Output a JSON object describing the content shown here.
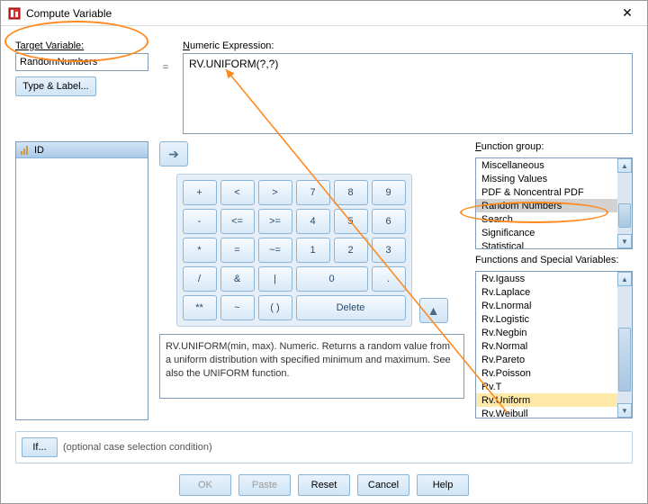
{
  "window": {
    "title": "Compute Variable"
  },
  "labels": {
    "target": "Target Variable:",
    "numeric": "Numeric Expression:",
    "type_label": "Type & Label...",
    "function_group": "Function group:",
    "functions_special": "Functions and Special Variables:",
    "if_hint": "(optional case selection condition)"
  },
  "values": {
    "target_variable": "RandomNumbers",
    "numeric_expression": "RV.UNIFORM(?,?)",
    "equals": "=",
    "variable_list_item": "ID"
  },
  "keypad": {
    "r0": [
      "+",
      "<",
      ">",
      "7",
      "8",
      "9"
    ],
    "r1": [
      "-",
      "<=",
      ">=",
      "4",
      "5",
      "6"
    ],
    "r2": [
      "*",
      "=",
      "~=",
      "1",
      "2",
      "3"
    ],
    "r3": [
      "/",
      "&",
      "|",
      "0",
      "."
    ],
    "r4": [
      "**",
      "~",
      "( )",
      "Delete"
    ]
  },
  "description": "RV.UNIFORM(min, max). Numeric. Returns a random value from a uniform distribution with specified minimum and maximum. See also the UNIFORM function.",
  "function_groups": [
    "Miscellaneous",
    "Missing Values",
    "PDF & Noncentral PDF",
    "Random Numbers",
    "Search",
    "Significance",
    "Statistical"
  ],
  "function_group_selected": "Random Numbers",
  "functions": [
    "Rv.Igauss",
    "Rv.Laplace",
    "Rv.Lnormal",
    "Rv.Logistic",
    "Rv.Negbin",
    "Rv.Normal",
    "Rv.Pareto",
    "Rv.Poisson",
    "Rv.T",
    "Rv.Uniform",
    "Rv.Weibull"
  ],
  "functions_selected": "Rv.Uniform",
  "buttons": {
    "if": "If...",
    "ok": "OK",
    "paste": "Paste",
    "reset": "Reset",
    "cancel": "Cancel",
    "help": "Help"
  }
}
